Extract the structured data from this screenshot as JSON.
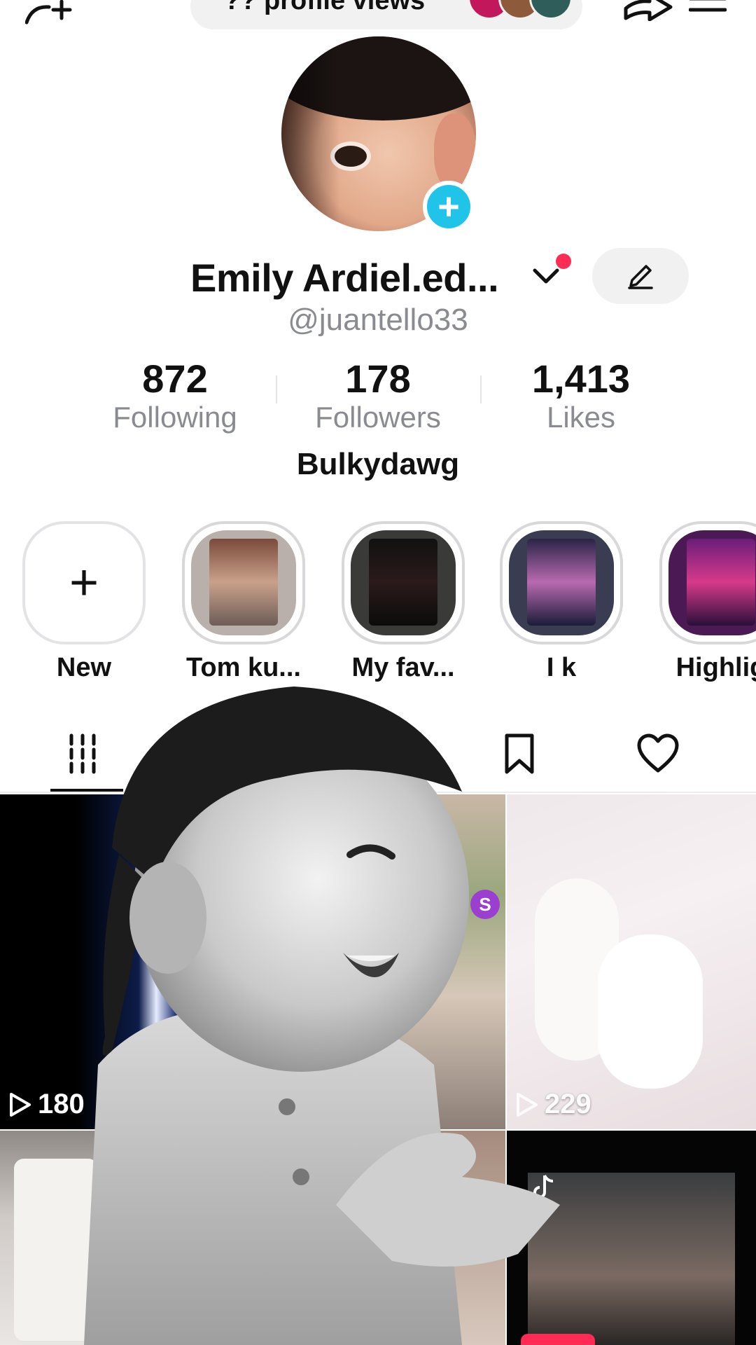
{
  "top_bar": {
    "profile_views_label": "profile views",
    "views_prefix": "??"
  },
  "profile": {
    "display_name": "Emily Ardiel.ed...",
    "username": "@juantello33",
    "bio": "Bulkydawg"
  },
  "stats": [
    {
      "value": "872",
      "label": "Following"
    },
    {
      "value": "178",
      "label": "Followers"
    },
    {
      "value": "1,413",
      "label": "Likes"
    }
  ],
  "highlights": [
    {
      "label": "New"
    },
    {
      "label": "Tom ku..."
    },
    {
      "label": "My fav..."
    },
    {
      "label": "I k"
    },
    {
      "label": "Highlig"
    }
  ],
  "tabs": {
    "icons": [
      "videos-grid-icon",
      "saved-bookmark-icon",
      "liked-heart-icon"
    ]
  },
  "videos": [
    {
      "views": "180"
    },
    {
      "views": ""
    },
    {
      "views": "229"
    }
  ],
  "colors": {
    "accent_cyan": "#21c4e9",
    "accent_red": "#fe2c55",
    "muted_text": "#8a8b91"
  }
}
